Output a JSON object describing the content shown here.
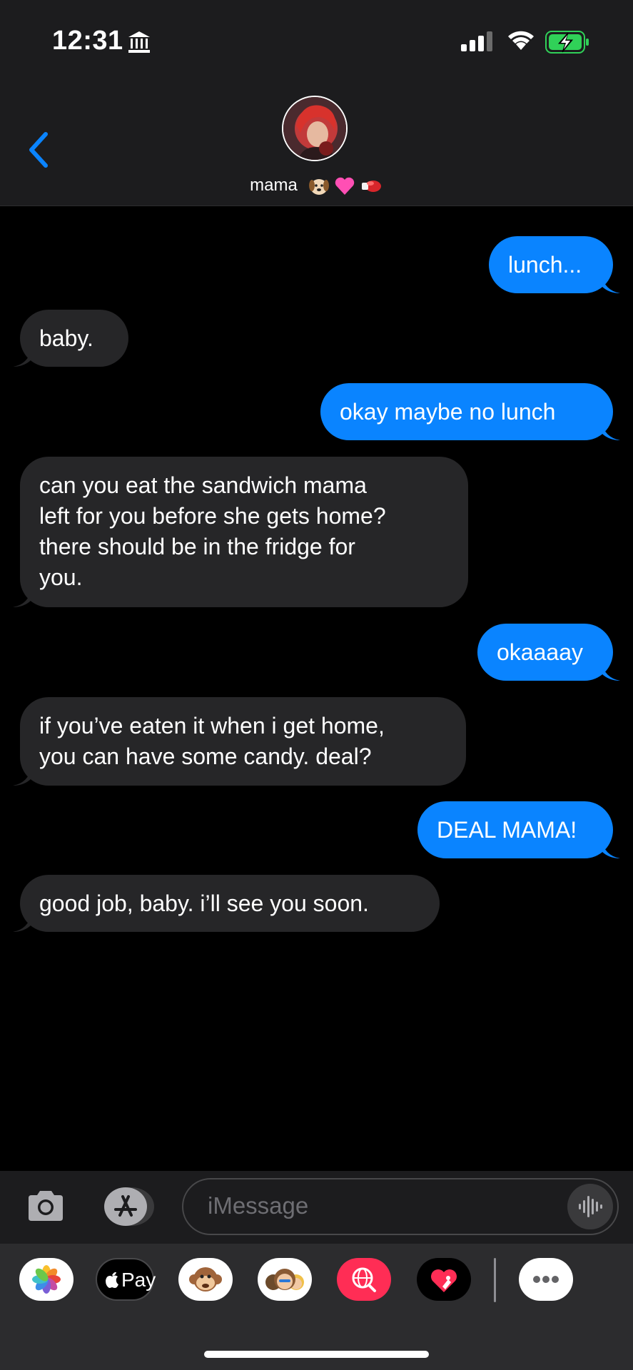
{
  "status_bar": {
    "time": "12:31",
    "icons": [
      "bank-icon",
      "signal-icon",
      "wifi-icon",
      "battery-charging-icon"
    ]
  },
  "header": {
    "back_icon": "chevron-left-icon",
    "contact_name": "mama",
    "contact_emojis": [
      "dog-face-emoji",
      "pink-heart-emoji",
      "boxing-glove-emoji"
    ]
  },
  "messages": [
    {
      "direction": "out",
      "text": "lunch..."
    },
    {
      "direction": "in",
      "text": "baby."
    },
    {
      "direction": "out",
      "text": "okay maybe no lunch"
    },
    {
      "direction": "in",
      "lines": [
        "can you eat the sandwich mama",
        "left for you before she gets home?",
        "there should be in the fridge for",
        "you."
      ]
    },
    {
      "direction": "out",
      "text": "okaaaay"
    },
    {
      "direction": "in",
      "lines": [
        "if you’ve eaten it when i get home,",
        "you can have some candy. deal?"
      ]
    },
    {
      "direction": "out",
      "text": "DEAL MAMA!"
    },
    {
      "direction": "in",
      "text": "good job, baby. i’ll see you soon."
    }
  ],
  "composer": {
    "placeholder": "iMessage",
    "icons": [
      "camera-icon",
      "app-store-icon",
      "audio-waveform-icon"
    ]
  },
  "app_drawer": {
    "apps": [
      "photos-app-icon",
      "apple-pay-app-icon",
      "animoji-app-icon",
      "memoji-app-icon",
      "image-search-app-icon",
      "digital-touch-app-icon",
      "more-apps-icon"
    ],
    "apple_pay_label": "Pay"
  },
  "colors": {
    "outgoing_bubble": "#0a84ff",
    "incoming_bubble": "#262628",
    "accent": "#0a84ff"
  }
}
